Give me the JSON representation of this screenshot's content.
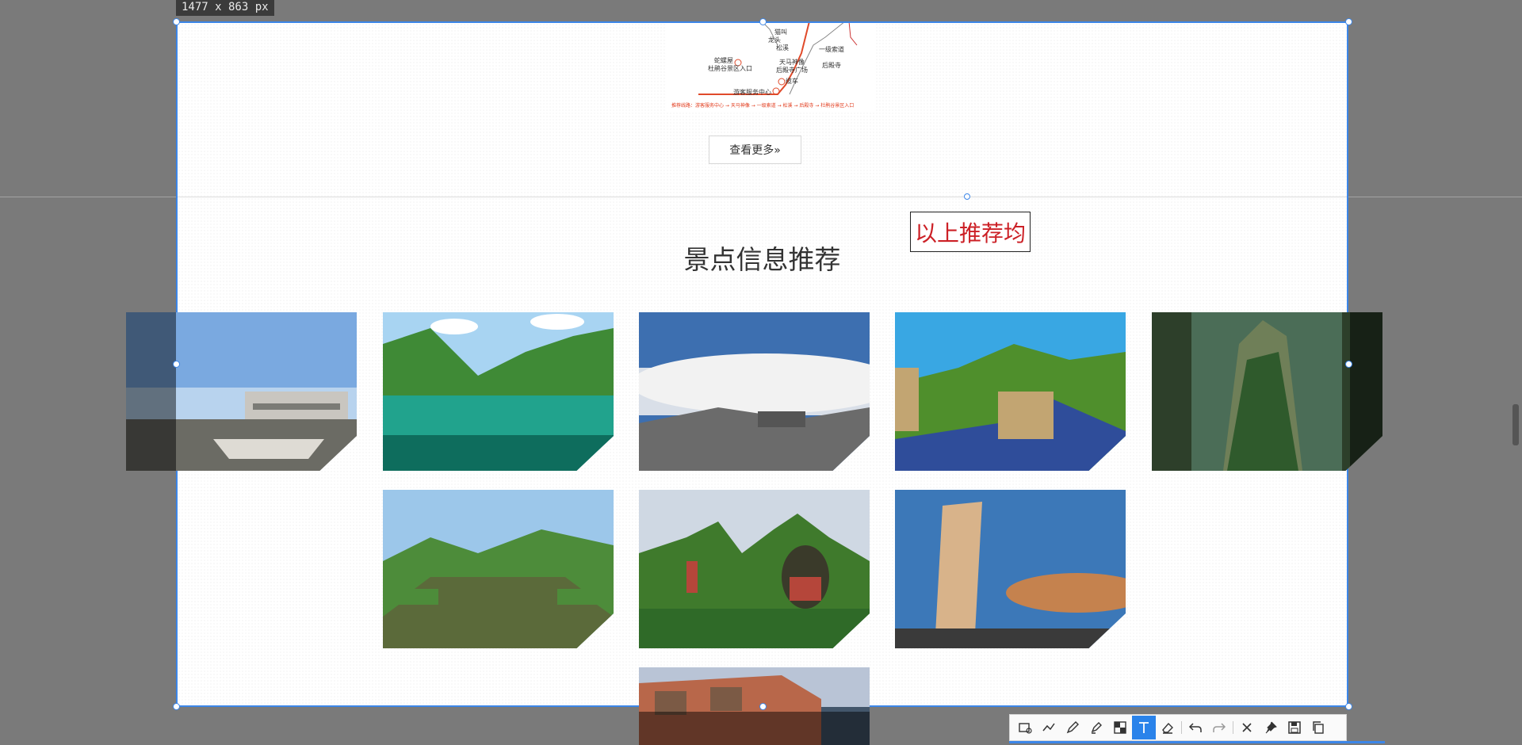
{
  "overlay": {
    "size_badge": "1477 x 863 px"
  },
  "page": {
    "map": {
      "labels": [
        "猫叫",
        "龙头",
        "松溪",
        "一级索道",
        "蛇螺屋",
        "杜鹃谷景区入口",
        "天马神像",
        "后殿寺广场",
        "后殿寺",
        "缆车",
        "游客服务中心"
      ],
      "route_text": "推荐线路：游客服务中心 → 天马神像 → 一级索道 → 松溪 → 后殿寺 → 杜鹃谷景区入口"
    },
    "more_button": "查看更多»",
    "section_title": "景点信息推荐",
    "annotation_text": "以上推荐均",
    "gallery": [
      {
        "name": "marble-boat",
        "colors": [
          "#7aa9e0",
          "#b8d3ee",
          "#c9c6c0",
          "#6b6b64"
        ]
      },
      {
        "name": "jiuzhai-lake",
        "colors": [
          "#a8d4f2",
          "#3f8a36",
          "#21a38d",
          "#0e6d5d"
        ]
      },
      {
        "name": "sea-of-clouds",
        "colors": [
          "#3d6fb0",
          "#d9dfe8",
          "#f2f2f2",
          "#6b6b6b"
        ]
      },
      {
        "name": "great-wall",
        "colors": [
          "#39a7e3",
          "#4f8f2c",
          "#c2a572",
          "#2f4d9a"
        ]
      },
      {
        "name": "karst-peak",
        "colors": [
          "#4b6d57",
          "#2f5a2c",
          "#6f7f58",
          "#2d3f2a"
        ]
      },
      {
        "name": "mountain-pavilion",
        "colors": [
          "#9cc7ea",
          "#4d8c3a",
          "#3a2c1e",
          "#5b6a3a"
        ]
      },
      {
        "name": "karst-cave",
        "colors": [
          "#cfd8e3",
          "#3f7a2c",
          "#2f6a28",
          "#b5463a"
        ]
      },
      {
        "name": "leaning-tower",
        "colors": [
          "#3c78b8",
          "#d8b38a",
          "#c5824e",
          "#3a3a3a"
        ]
      },
      {
        "name": "cliff-village",
        "colors": [
          "#b9c4d6",
          "#b8674a",
          "#7b5a45",
          "#43566b"
        ]
      }
    ]
  },
  "toolbar": {
    "tools": [
      "rectangle-icon",
      "polyline-icon",
      "pen-icon",
      "marker-icon",
      "mosaic-icon",
      "text-icon",
      "eraser-icon",
      "undo-icon",
      "redo-icon",
      "close-icon",
      "pin-icon",
      "save-icon",
      "copy-icon"
    ],
    "active_tool": "text-icon",
    "accent_color": "#2a83ea"
  }
}
